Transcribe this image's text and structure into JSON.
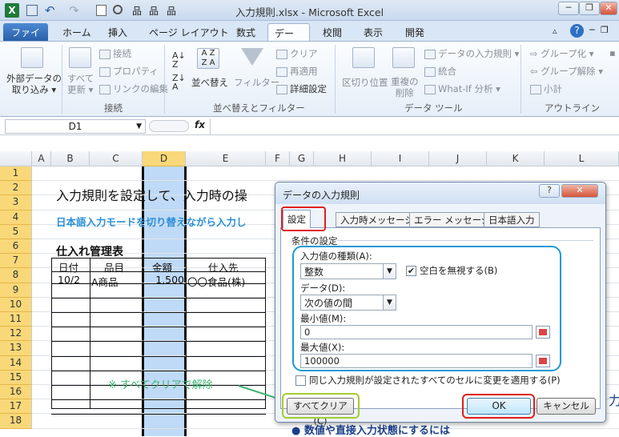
{
  "window": {
    "title": "入力規則.xlsx - Microsoft Excel"
  },
  "qat": {
    "app_icon": "X",
    "undo": "↶",
    "redo": "↷"
  },
  "window_controls": {
    "minimize": "─",
    "restore": "❐",
    "close": "✕"
  },
  "tabs": [
    {
      "label": "ファイル"
    },
    {
      "label": "ホーム"
    },
    {
      "label": "挿入"
    },
    {
      "label": "ページ レイアウト"
    },
    {
      "label": "数式"
    },
    {
      "label": "データ"
    },
    {
      "label": "校閲"
    },
    {
      "label": "表示"
    },
    {
      "label": "開発"
    }
  ],
  "ribbon": {
    "external_data": "外部データの\n取り込み ▾",
    "refresh_all": "すべて\n更新 ▾",
    "connections": "接続",
    "properties": "プロパティ",
    "edit_links": "リンクの編集",
    "group_connections": "接続",
    "sort": "並べ替え",
    "filter": "フィルター",
    "clear": "クリア",
    "reapply": "再適用",
    "advanced": "詳細設定",
    "group_sort_filter": "並べ替えとフィルター",
    "text_to_columns": "区切り位置",
    "remove_duplicates": "重複の\n削除",
    "data_validation": "データの入力規則 ▾",
    "consolidate": "統合",
    "what_if": "What-If 分析 ▾",
    "group_data_tools": "データ ツール",
    "group": "グループ化 ▾",
    "ungroup": "グループ解除 ▾",
    "subtotal": "小計",
    "group_outline": "アウトライン"
  },
  "formula_bar": {
    "name_box": "D1",
    "fx": "fx"
  },
  "columns": [
    "A",
    "B",
    "C",
    "D",
    "E",
    "F",
    "G",
    "H",
    "I",
    "J",
    "K",
    "L"
  ],
  "rows": [
    "1",
    "2",
    "3",
    "4",
    "5",
    "6",
    "7",
    "8",
    "9",
    "10",
    "11",
    "12",
    "13",
    "14",
    "15",
    "16",
    "17",
    "18"
  ],
  "sheet": {
    "heading": "入力規則を設定して、入力時の操",
    "subheading": "日本語入力モードを切り替えながら入力し",
    "table_title": "仕入れ管理表",
    "headers": [
      "日付",
      "品目",
      "金額",
      "仕入先"
    ],
    "row8": [
      "10/2",
      "A商品",
      "1,500",
      "〇〇食品(株)"
    ],
    "note": "※ すべてクリアで解除",
    "bottom_text": "● 数値や直接入力状態にするには",
    "right_edge": "力"
  },
  "dialog": {
    "title": "データの入力規則",
    "help": "?",
    "close": "✕",
    "tabs": [
      "設定",
      "入力時メッセージ",
      "エラー メッセージ",
      "日本語入力"
    ],
    "criteria_label": "条件の設定",
    "allow_label": "入力値の種類(A):",
    "allow_value": "整数",
    "ignore_blank": "空白を無視する(B)",
    "data_label": "データ(D):",
    "data_value": "次の値の間",
    "min_label": "最小値(M):",
    "min_value": "0",
    "max_label": "最大値(X):",
    "max_value": "100000",
    "apply_all": "同じ入力規則が設定されたすべてのセルに変更を適用する(P)",
    "clear_all": "すべてクリア(C)",
    "ok": "OK",
    "cancel": "キャンセル"
  },
  "colors": {
    "highlight_red": "#e0201c",
    "highlight_blue": "#1a9ad6",
    "highlight_green": "#a4cc30",
    "note_green": "#3cb371",
    "sub_blue": "#2a8fd8",
    "sub_orange": "#ff8c1a"
  }
}
